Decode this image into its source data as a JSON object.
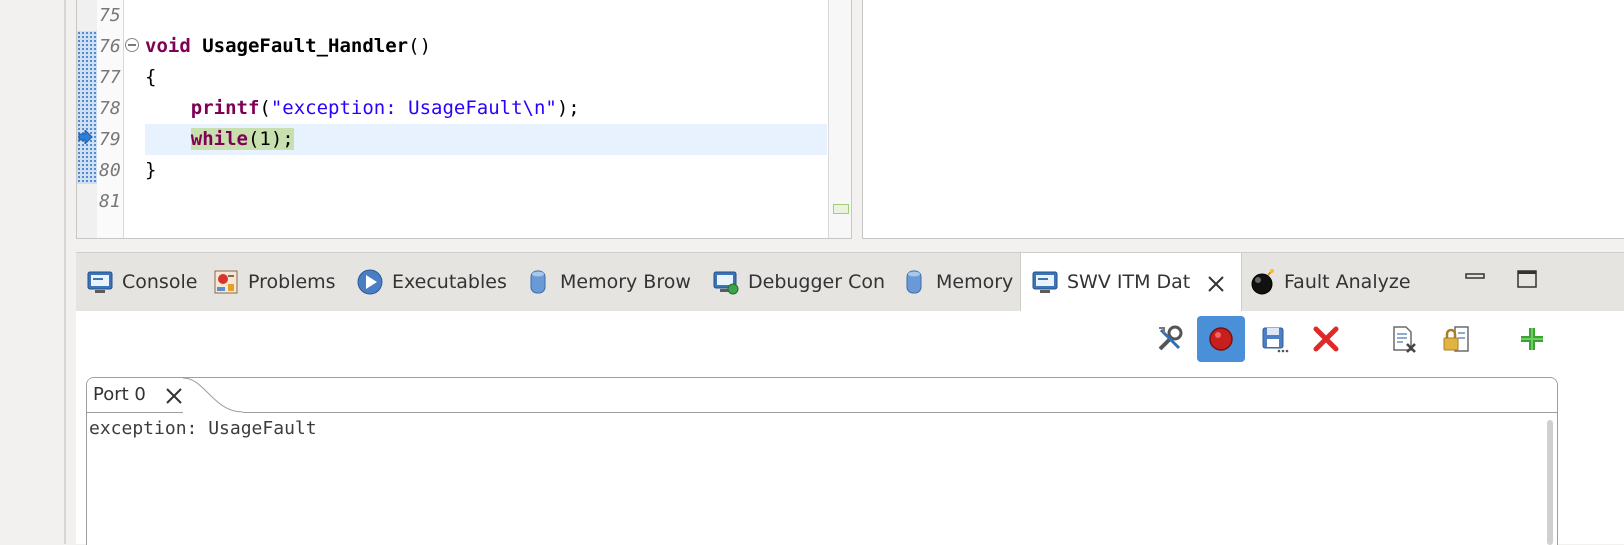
{
  "editor": {
    "lines": [
      {
        "num": "75",
        "tokens": []
      },
      {
        "num": "76",
        "tokens": [
          {
            "t": "kw",
            "v": "void"
          },
          {
            "t": "plain",
            "v": " "
          },
          {
            "t": "fn",
            "v": "UsageFault_Handler"
          },
          {
            "t": "plain",
            "v": "()"
          }
        ]
      },
      {
        "num": "77",
        "tokens": [
          {
            "t": "plain",
            "v": "{"
          }
        ]
      },
      {
        "num": "78",
        "tokens": [
          {
            "t": "plain",
            "v": "    "
          },
          {
            "t": "kw",
            "v": "printf"
          },
          {
            "t": "plain",
            "v": "("
          },
          {
            "t": "str",
            "v": "\"exception: UsageFault\\n\""
          },
          {
            "t": "plain",
            "v": ");"
          }
        ]
      },
      {
        "num": "79",
        "current": true,
        "tokens": [
          {
            "t": "plain",
            "v": "    "
          },
          {
            "t": "kw hl",
            "v": "while"
          },
          {
            "t": "hl",
            "v": "(1);"
          }
        ]
      },
      {
        "num": "80",
        "tokens": [
          {
            "t": "plain",
            "v": "}"
          }
        ]
      },
      {
        "num": "81",
        "tokens": []
      }
    ]
  },
  "tabs": [
    {
      "label": "Console",
      "icon": "console-icon"
    },
    {
      "label": "Problems",
      "icon": "problems-icon"
    },
    {
      "label": "Executables",
      "icon": "executables-icon"
    },
    {
      "label": "Memory Brow",
      "icon": "memory-browser-icon"
    },
    {
      "label": "Debugger Con",
      "icon": "debugger-console-icon"
    },
    {
      "label": "Memory",
      "icon": "memory-icon"
    },
    {
      "label": "SWV ITM Dat",
      "icon": "swv-itm-icon",
      "active": true
    },
    {
      "label": "Fault Analyze",
      "icon": "fault-analyzer-icon"
    }
  ],
  "toolbar": [
    "configure-trace-icon",
    "start-trace-icon",
    "save-icon",
    "remove-icon",
    "clear-icon",
    "lock-icon",
    "add-port-icon"
  ],
  "port_tab": {
    "label": "Port 0"
  },
  "console_output": "exception: UsageFault",
  "colors": {
    "keyword": "#7f0055",
    "string": "#2a00ff",
    "current_line": "#e8f2fe",
    "pressed": "#4a90d9"
  }
}
